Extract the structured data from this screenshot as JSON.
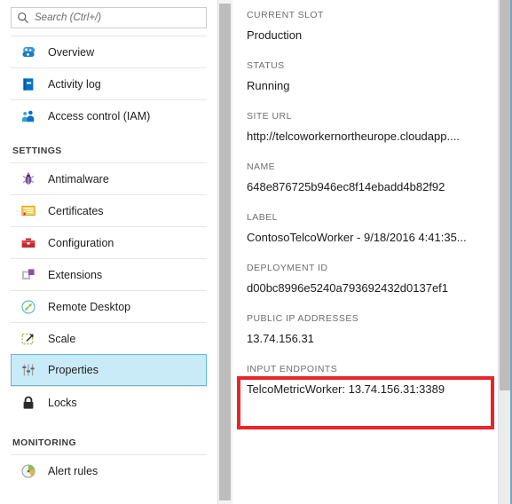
{
  "search": {
    "placeholder": "Search (Ctrl+/)",
    "value": "",
    "icon": "search-icon"
  },
  "sidebar": {
    "top_items": [
      {
        "label": "Overview",
        "icon": "overview-icon",
        "selected": false
      },
      {
        "label": "Activity log",
        "icon": "activity-log-icon",
        "selected": false
      },
      {
        "label": "Access control (IAM)",
        "icon": "access-control-icon",
        "selected": false
      }
    ],
    "settings_header": "SETTINGS",
    "settings_items": [
      {
        "label": "Antimalware",
        "icon": "bug-icon",
        "selected": false
      },
      {
        "label": "Certificates",
        "icon": "certificate-icon",
        "selected": false
      },
      {
        "label": "Configuration",
        "icon": "toolbox-icon",
        "selected": false
      },
      {
        "label": "Extensions",
        "icon": "extensions-icon",
        "selected": false
      },
      {
        "label": "Remote Desktop",
        "icon": "remote-desktop-icon",
        "selected": false
      },
      {
        "label": "Scale",
        "icon": "scale-icon",
        "selected": false
      },
      {
        "label": "Properties",
        "icon": "sliders-icon",
        "selected": true
      },
      {
        "label": "Locks",
        "icon": "lock-icon",
        "selected": false
      }
    ],
    "monitoring_header": "MONITORING",
    "monitoring_items": [
      {
        "label": "Alert rules",
        "icon": "alert-rules-icon",
        "selected": false
      }
    ]
  },
  "properties": [
    {
      "label": "CURRENT SLOT",
      "value": "Production"
    },
    {
      "label": "STATUS",
      "value": "Running"
    },
    {
      "label": "SITE URL",
      "value": "http://telcoworkernortheurope.cloudapp...."
    },
    {
      "label": "NAME",
      "value": "648e876725b946ec8f14ebadd4b82f92"
    },
    {
      "label": "LABEL",
      "value": "ContosoTelcoWorker - 9/18/2016 4:41:35..."
    },
    {
      "label": "DEPLOYMENT ID",
      "value": "d00bc8996e5240a793692432d0137ef1"
    },
    {
      "label": "PUBLIC IP ADDRESSES",
      "value": "13.74.156.31"
    },
    {
      "label": "INPUT ENDPOINTS",
      "value": "TelcoMetricWorker: 13.74.156.31:3389"
    }
  ],
  "annotation": {
    "highlight_color": "#e8252a",
    "highlights_group_label": "PUBLIC IP ADDRESSES"
  },
  "colors": {
    "selected_row_bg": "#c9eaf7",
    "selected_row_border": "#60b9dc",
    "accent_blue": "#0072c6",
    "label_gray": "#6e6e6e"
  }
}
